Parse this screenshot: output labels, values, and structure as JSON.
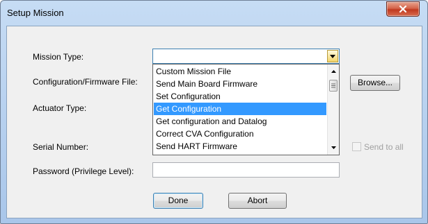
{
  "window": {
    "title": "Setup Mission",
    "close_icon": "close-x-icon"
  },
  "form": {
    "mission_type_label": "Mission Type:",
    "mission_type_value": "",
    "config_file_label": "Configuration/Firmware File:",
    "browse_label": "Browse...",
    "actuator_type_label": "Actuator Type:",
    "serial_number_label": "Serial Number:",
    "send_to_all_label": "Send to all",
    "send_to_all_checked": false,
    "password_label": "Password (Privilege Level):",
    "password_value": ""
  },
  "dropdown": {
    "items": [
      "Custom Mission File",
      "Send Main Board Firmware",
      "Set Configuration",
      "Get Configuration",
      "Get configuration and Datalog",
      "Correct CVA Configuration",
      "Send HART Firmware"
    ],
    "selected_index": 3
  },
  "buttons": {
    "done_label": "Done",
    "abort_label": "Abort"
  },
  "colors": {
    "selection": "#3399ff",
    "close_button": "#c0391f",
    "title_gradient_top": "#c6dcf4"
  }
}
